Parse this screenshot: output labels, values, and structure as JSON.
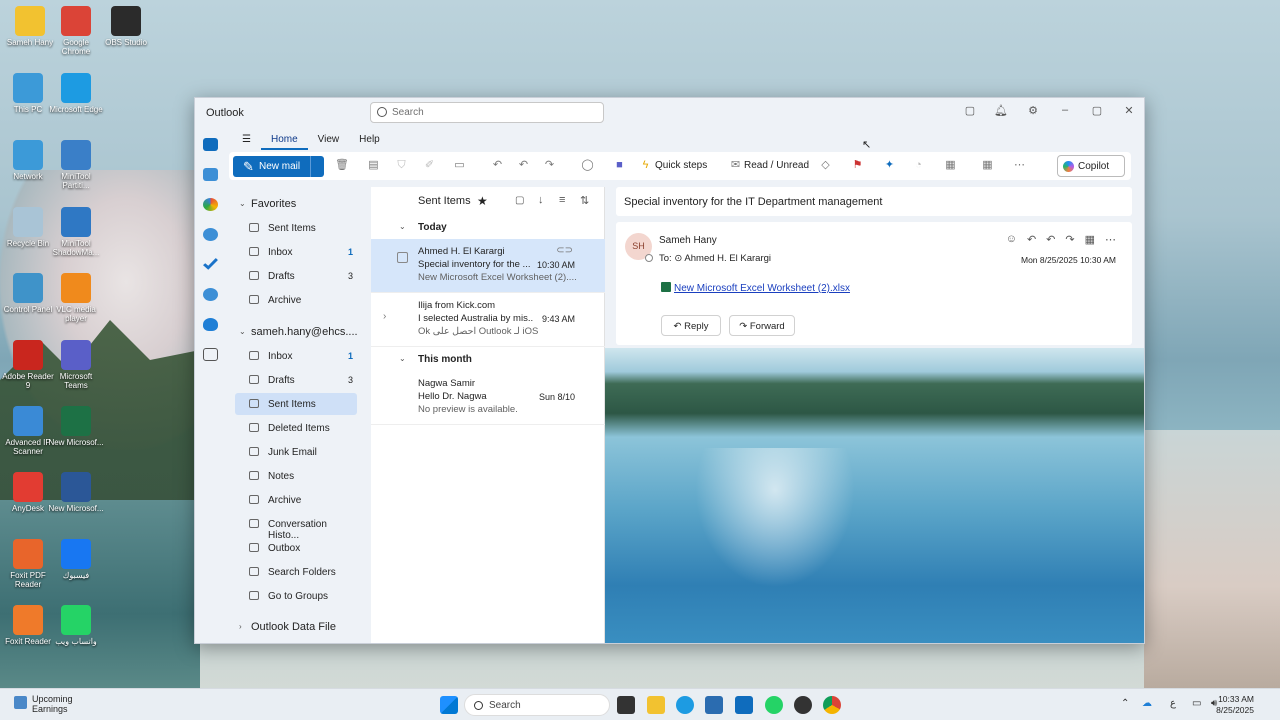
{
  "desktop": {
    "icons": [
      {
        "label": "Sameh Hany",
        "color": "#f2c230"
      },
      {
        "label": "Google Chrome",
        "color": "#db4437"
      },
      {
        "label": "OBS Studio",
        "color": "#2b2b2b"
      },
      {
        "label": "This PC",
        "color": "#3c9ad8"
      },
      {
        "label": "Microsoft Edge",
        "color": "#1d9be2"
      },
      {
        "label": "Network",
        "color": "#3c9ad8"
      },
      {
        "label": "MiniTool Partiti...",
        "color": "#3a7fc8"
      },
      {
        "label": "Recycle Bin",
        "color": "#a9c4d6"
      },
      {
        "label": "MiniTool ShadowMa...",
        "color": "#2f78c4"
      },
      {
        "label": "Control Panel",
        "color": "#3f93c9"
      },
      {
        "label": "VLC media player",
        "color": "#f08a1c"
      },
      {
        "label": "Adobe Reader 9",
        "color": "#c9261e"
      },
      {
        "label": "Microsoft Teams",
        "color": "#5a5fc8"
      },
      {
        "label": "Advanced IP Scanner",
        "color": "#3a8ad6"
      },
      {
        "label": "New Microsof...",
        "color": "#1d7145"
      },
      {
        "label": "AnyDesk",
        "color": "#e23c32"
      },
      {
        "label": "New Microsof...",
        "color": "#2b5797"
      },
      {
        "label": "Foxit PDF Reader",
        "color": "#e8652b"
      },
      {
        "label": "فيسبوك",
        "color": "#1877f2"
      },
      {
        "label": "Foxit Reader",
        "color": "#ef7a2a"
      },
      {
        "label": "واتساب ويب",
        "color": "#25d366"
      }
    ]
  },
  "window": {
    "title": "Outlook",
    "search_placeholder": "Search",
    "menu": {
      "home": "Home",
      "view": "View",
      "help": "Help"
    },
    "ribbon": {
      "new_mail": "New mail",
      "quick_steps": "Quick steps",
      "read_unread": "Read / Unread",
      "copilot": "Copilot"
    },
    "folders": {
      "favorites_header": "Favorites",
      "favorites": [
        {
          "label": "Sent Items",
          "count": ""
        },
        {
          "label": "Inbox",
          "count": "1"
        },
        {
          "label": "Drafts",
          "count": "3"
        },
        {
          "label": "Archive",
          "count": ""
        }
      ],
      "account": "sameh.hany@ehcs....",
      "account_items": [
        {
          "label": "Inbox",
          "count": "1"
        },
        {
          "label": "Drafts",
          "count": "3"
        },
        {
          "label": "Sent Items",
          "count": ""
        },
        {
          "label": "Deleted Items",
          "count": ""
        },
        {
          "label": "Junk Email",
          "count": ""
        },
        {
          "label": "Notes",
          "count": ""
        },
        {
          "label": "Archive",
          "count": ""
        },
        {
          "label": "Conversation Histo...",
          "count": ""
        },
        {
          "label": "Outbox",
          "count": ""
        },
        {
          "label": "Search Folders",
          "count": ""
        },
        {
          "label": "Go to Groups",
          "count": ""
        }
      ],
      "data_file": "Outlook Data File"
    },
    "message_list": {
      "title": "Sent Items",
      "group_today": "Today",
      "group_month": "This month",
      "messages": [
        {
          "from": "Ahmed H. El Karargi",
          "subject": "Special inventory for the ...",
          "preview": "New Microsoft Excel Worksheet (2)....",
          "time": "10:30 AM"
        },
        {
          "from": "Ilija from Kick.com",
          "subject": "I selected Australia by mis...",
          "preview": "Ok احصل على Outlook لـ iOS",
          "time": "9:43 AM"
        },
        {
          "from": "Nagwa Samir",
          "subject": "Hello Dr. Nagwa",
          "preview": "No preview is available.",
          "time": "Sun 8/10"
        }
      ]
    },
    "reading": {
      "subject": "Special inventory for the IT Department management",
      "avatar": "SH",
      "sender": "Sameh Hany",
      "to_label": "To:",
      "to": "Ahmed H. El Karargi",
      "date": "Mon 8/25/2025 10:30 AM",
      "attachment": "New Microsoft Excel Worksheet (2).xlsx",
      "reply": "Reply",
      "forward": "Forward"
    }
  },
  "taskbar": {
    "weather_title": "Upcoming",
    "weather_sub": "Earnings",
    "search": "Search",
    "time": "10:33 AM",
    "date": "8/25/2025"
  }
}
